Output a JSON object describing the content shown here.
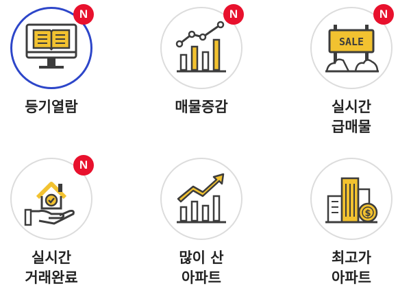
{
  "badge_text": "N",
  "colors": {
    "accent_yellow": "#f2c230",
    "dark": "#3c3c3c",
    "selected_ring": "#2d46c9",
    "badge": "#e8112d"
  },
  "tiles": [
    {
      "icon": "registry-book-monitor-icon",
      "lines": [
        "등기열람"
      ],
      "badge": true,
      "selected": true
    },
    {
      "icon": "rising-sales-chart-icon",
      "lines": [
        "매물증감"
      ],
      "badge": true,
      "selected": false
    },
    {
      "icon": "sale-sign-icon",
      "lines": [
        "실시간",
        "급매물"
      ],
      "badge": true,
      "selected": false
    },
    {
      "icon": "house-in-hand-icon",
      "lines": [
        "실시간",
        "거래완료"
      ],
      "badge": true,
      "selected": false
    },
    {
      "icon": "trending-bar-chart-icon",
      "lines": [
        "많이 산",
        "아파트"
      ],
      "badge": false,
      "selected": false
    },
    {
      "icon": "buildings-coin-icon",
      "lines": [
        "최고가",
        "아파트"
      ],
      "badge": false,
      "selected": false
    }
  ],
  "sale_sign_text": "SALE"
}
